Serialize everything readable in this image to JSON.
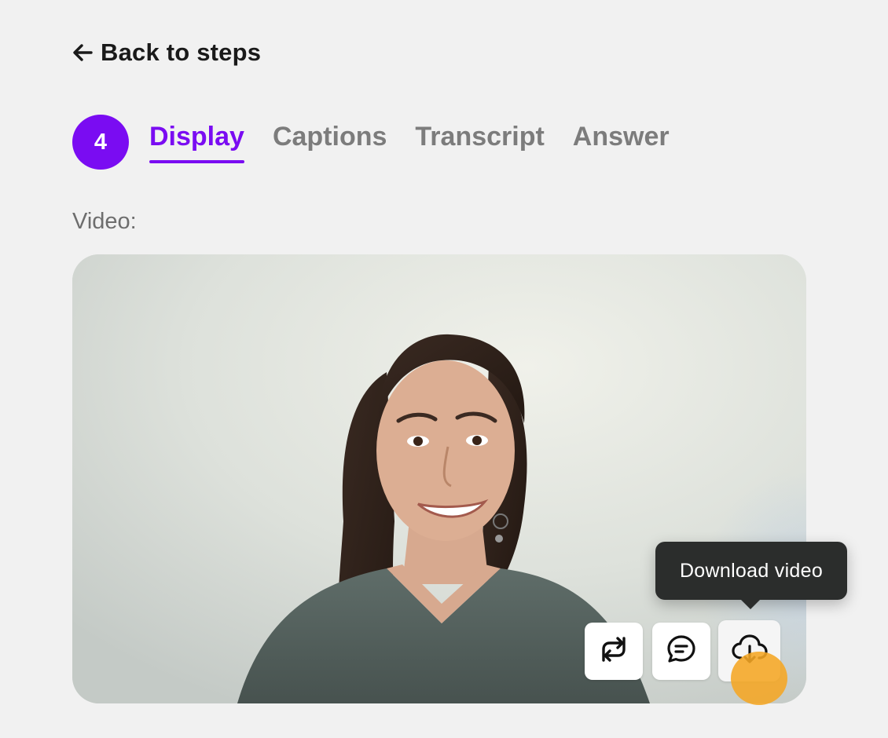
{
  "nav": {
    "back_label": "Back to steps"
  },
  "step": {
    "number": "4"
  },
  "tabs": [
    {
      "label": "Display",
      "active": true
    },
    {
      "label": "Captions",
      "active": false
    },
    {
      "label": "Transcript",
      "active": false
    },
    {
      "label": "Answer",
      "active": false
    }
  ],
  "video": {
    "label": "Video:",
    "tooltip": "Download video",
    "controls": [
      {
        "icon": "swap-icon"
      },
      {
        "icon": "speech-bubble-icon"
      },
      {
        "icon": "cloud-download-icon"
      }
    ]
  },
  "colors": {
    "accent": "#7a0cf2",
    "tab_inactive": "#7c7c7c",
    "tooltip_bg": "#2b2d2c",
    "cursor_highlight": "#f5a623",
    "page_bg": "#f1f1f1"
  }
}
